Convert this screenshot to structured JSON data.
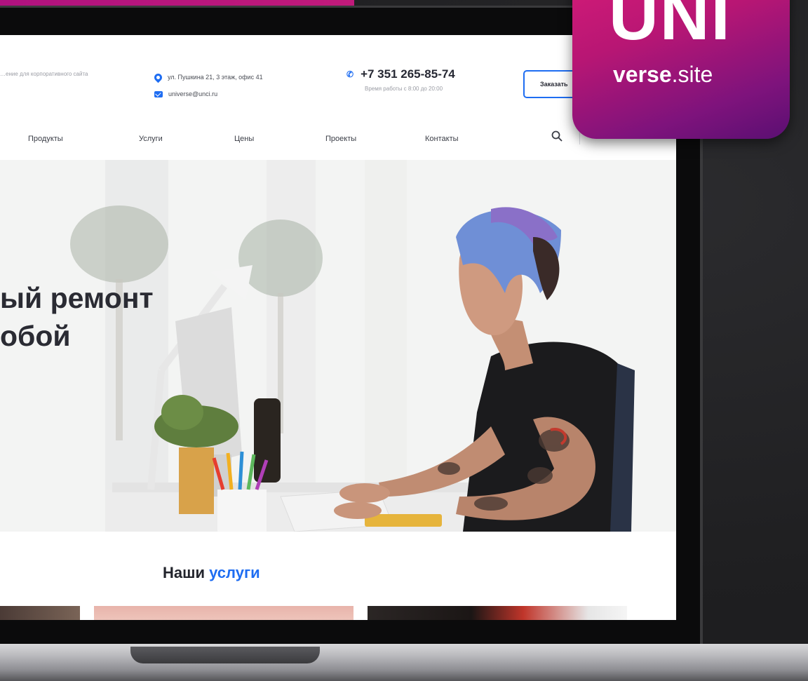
{
  "header": {
    "tagline": "…ение для корпоративного сайта",
    "address": "ул. Пушкина 21, 3 этаж, офис 41",
    "email": "universe@unci.ru",
    "phone": "+7 351 265-85-74",
    "hours": "Время работы с 8:00 до 20:00",
    "order_button": "Заказать"
  },
  "nav": {
    "items": [
      "Продукты",
      "Услуги",
      "Цены",
      "Проекты",
      "Контакты"
    ]
  },
  "hero": {
    "title": "ый ремонт\nобой"
  },
  "services": {
    "title_plain": "Наши",
    "title_highlight": "услуги"
  },
  "badge": {
    "brand_top": "UNI",
    "brand_bold": "verse",
    "brand_light": ".site"
  },
  "colors": {
    "accent_blue": "#1e6df2",
    "brand_magenta": "#c0177a",
    "brand_purple": "#5a0f72"
  }
}
